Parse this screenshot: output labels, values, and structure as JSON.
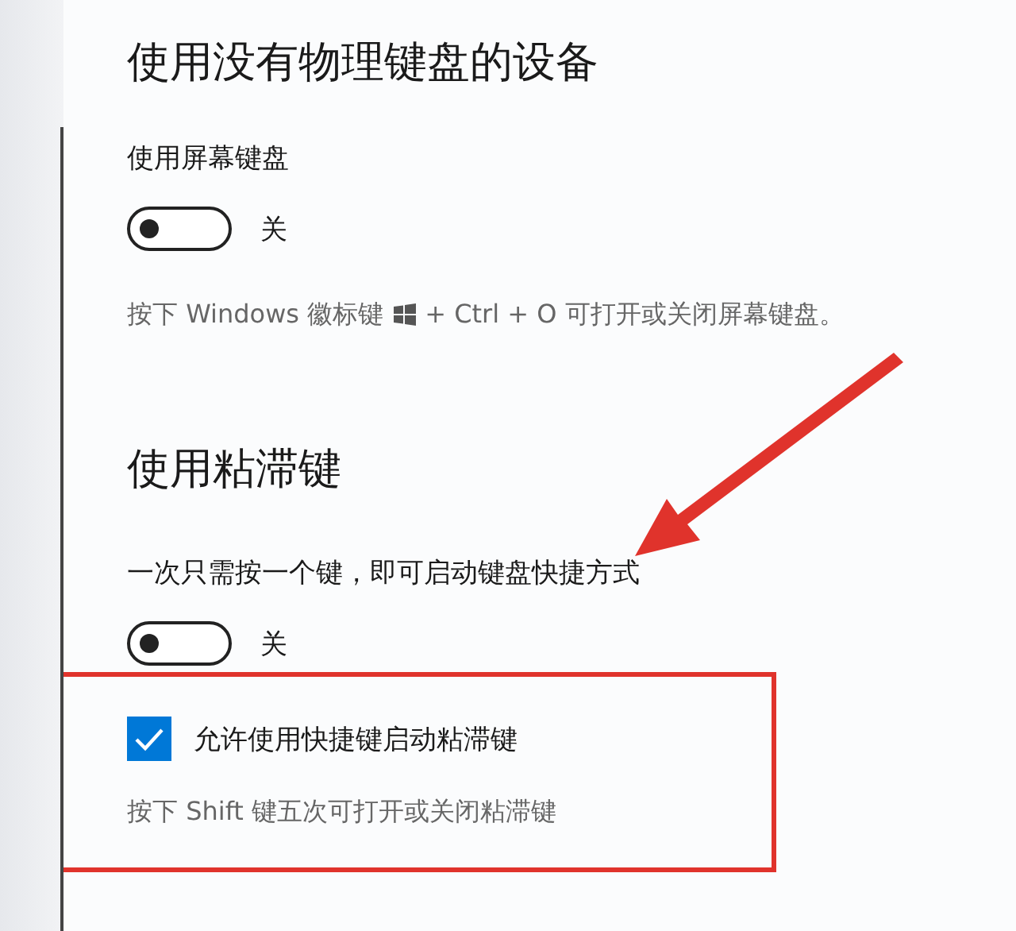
{
  "sections": [
    {
      "title": "使用没有物理键盘的设备",
      "items": [
        {
          "kind": "label",
          "text": "使用屏幕键盘"
        },
        {
          "kind": "toggle",
          "on": false,
          "text": "关"
        },
        {
          "kind": "hint",
          "parts": [
            "按下 Windows 徽标键",
            "+ Ctrl + O 可打开或关闭屏幕键盘。"
          ]
        }
      ]
    },
    {
      "title": "使用粘滞键",
      "items": [
        {
          "kind": "label",
          "text": "一次只需按一个键，即可启动键盘快捷方式"
        },
        {
          "kind": "toggle",
          "on": false,
          "text": "关"
        }
      ],
      "framed_items": [
        {
          "kind": "checkbox",
          "checked": true,
          "text": "允许使用快捷键启动粘滞键"
        },
        {
          "kind": "hint",
          "parts": [
            "按下 Shift 键五次可打开或关闭粘滞键"
          ]
        }
      ]
    }
  ]
}
